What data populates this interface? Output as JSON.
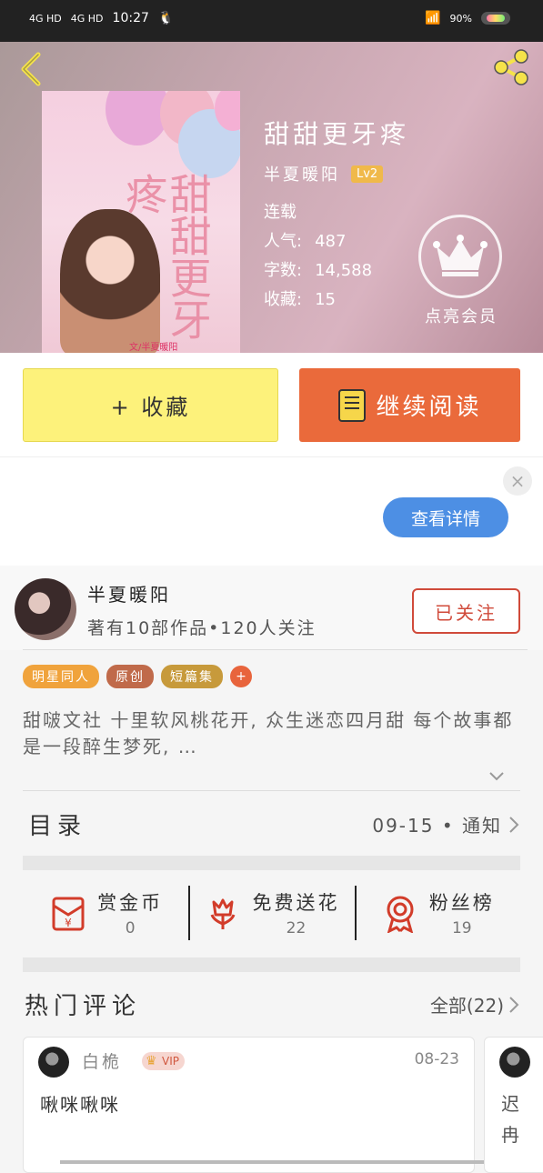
{
  "statusbar": {
    "net1": "4G HD",
    "net2": "4G HD",
    "time": "10:27",
    "battery": "90%"
  },
  "book": {
    "title": "甜甜更牙疼",
    "author": "半夏暖阳",
    "level": "Lv2",
    "status": "连载",
    "popularity_label": "人气:",
    "popularity": "487",
    "words_label": "字数:",
    "words": "14,588",
    "favorites_label": "收藏:",
    "favorites": "15",
    "cover_title": "甜甜更牙疼",
    "cover_caption": "文/半夏暖阳"
  },
  "vip": {
    "label": "点亮会员"
  },
  "actions": {
    "collect": "+ 收藏",
    "read": "继续阅读"
  },
  "ad": {
    "details": "查看详情",
    "close": "×"
  },
  "author_card": {
    "name": "半夏暖阳",
    "meta": "著有10部作品•120人关注",
    "follow": "已关注"
  },
  "tags": [
    {
      "label": "明星同人",
      "color": "#f0a33c"
    },
    {
      "label": "原创",
      "color": "#c06a4a"
    },
    {
      "label": "短篇集",
      "color": "#c79a3b"
    }
  ],
  "tag_more": "+",
  "description": "甜啵文社 十里软风桃花开, 众生迷恋四月甜 每个故事都是一段醉生梦死, …",
  "toc": {
    "title": "目录",
    "latest": "09-15 • 通知"
  },
  "stats": [
    {
      "label": "赏金币",
      "value": "0",
      "icon": "red-envelope-icon"
    },
    {
      "label": "免费送花",
      "value": "22",
      "icon": "flower-icon"
    },
    {
      "label": "粉丝榜",
      "value": "19",
      "icon": "medal-icon"
    }
  ],
  "hot_comments": {
    "title": "热门评论",
    "all": "全部(22)"
  },
  "comments": [
    {
      "user": "白桅",
      "badge": "VIP",
      "date": "08-23",
      "text": "啾咪啾咪"
    },
    {
      "text": "迟冉"
    }
  ]
}
